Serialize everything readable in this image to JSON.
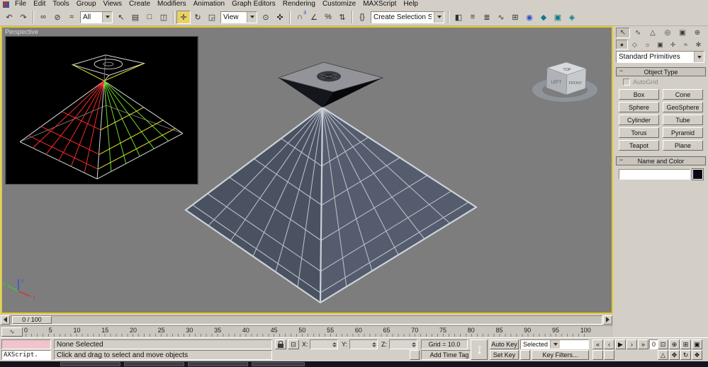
{
  "ui": {
    "minus": "−"
  },
  "menu": {
    "items": [
      "File",
      "Edit",
      "Tools",
      "Group",
      "Views",
      "Create",
      "Modifiers",
      "Animation",
      "Graph Editors",
      "Rendering",
      "Customize",
      "MAXScript",
      "Help"
    ]
  },
  "toolbar": {
    "selection_filter": "All",
    "coord_system": "View",
    "selection_set": "Create Selection Set",
    "snap_badge": "3",
    "icons": {
      "undo": "↶",
      "redo": "↷",
      "link": "∞",
      "unlink": "⊘",
      "bind": "≈",
      "select": "↖",
      "select_by_name": "▤",
      "region": "□",
      "crossing": "◫",
      "move": "✛",
      "rotate": "↻",
      "scale": "◲",
      "center": "⊙",
      "manipulate": "✜",
      "snap": "∩",
      "angle_snap": "∠",
      "percent_snap": "%",
      "spinner_snap": "⇅",
      "named_sets": "{}",
      "mirror": "◧",
      "align": "≡",
      "layers": "≣",
      "curve_editor": "∿",
      "schematic": "⊞",
      "material": "◉",
      "render_setup": "◆",
      "render_type": "▣",
      "quick_render": "◈"
    }
  },
  "viewport": {
    "label": "Perspective",
    "viewcube": {
      "top": "TOP",
      "left": "LEFT",
      "front": "FRONT"
    },
    "axis": {
      "x": "x",
      "y": "y",
      "z": "z"
    }
  },
  "panel": {
    "tabs": {
      "create": "↖",
      "modify": "∿",
      "hierarchy": "△",
      "motion": "◎",
      "display": "▣",
      "utilities": "⊕"
    },
    "cats": {
      "geometry": "●",
      "shapes": "◇",
      "lights": "☼",
      "cameras": "▣",
      "helpers": "✛",
      "spacewarps": "≈",
      "systems": "✻"
    },
    "dropdown": "Standard Primitives",
    "object_type": "Object Type",
    "autogrid": "AutoGrid",
    "buttons": [
      "Box",
      "Cone",
      "Sphere",
      "GeoSphere",
      "Cylinder",
      "Tube",
      "Torus",
      "Pyramid",
      "Teapot",
      "Plane"
    ],
    "name_and_color": "Name and Color",
    "name_value": ""
  },
  "timeline": {
    "slider": "0 / 100",
    "curve_btn": "∿",
    "ticks": [
      "0",
      "5",
      "10",
      "15",
      "20",
      "25",
      "30",
      "35",
      "40",
      "45",
      "50",
      "55",
      "60",
      "65",
      "70",
      "75",
      "80",
      "85",
      "90",
      "95",
      "100"
    ]
  },
  "status": {
    "listener": "AXScript.",
    "selection": "None Selected",
    "prompt": "Click and drag to select and move objects",
    "abs_toggle": "⊡",
    "x": "X:",
    "y": "Y:",
    "z": "Z:",
    "x_val": "",
    "y_val": "",
    "z_val": "",
    "grid": "Grid = 10.0",
    "time_tag": "Add Time Tag",
    "key_glyph": "⊶",
    "auto_key": "Auto Key",
    "set_key": "Set Key",
    "key_mode": "Selected",
    "key_filters": "Key Filters...",
    "tc": [
      "«",
      "‹",
      "▶",
      "›",
      "»"
    ],
    "frame": "0",
    "nav": {
      "zoom": "⊕",
      "zoom_all": "⊞",
      "extents": "▣",
      "region": "⊡",
      "fov": "△",
      "pan": "✥",
      "orbit": "↻",
      "maximize": "❖"
    }
  }
}
